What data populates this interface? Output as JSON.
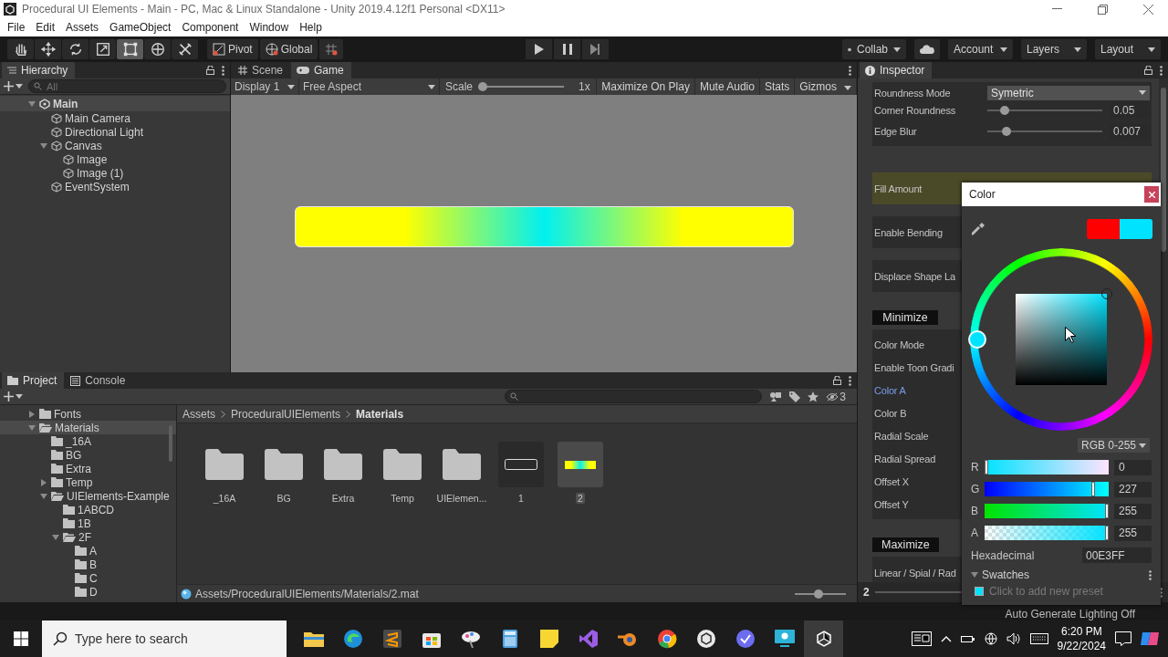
{
  "window": {
    "title": "Procedural UI Elements - Main - PC, Mac & Linux Standalone - Unity 2019.4.12f1 Personal <DX11>"
  },
  "menu": [
    "File",
    "Edit",
    "Assets",
    "GameObject",
    "Component",
    "Window",
    "Help"
  ],
  "toolbar": {
    "tools": [
      {
        "kind": "hand",
        "selected": false
      },
      {
        "kind": "move",
        "selected": false
      },
      {
        "kind": "rotate",
        "selected": false
      },
      {
        "kind": "scale",
        "selected": false
      },
      {
        "kind": "rect",
        "selected": true
      },
      {
        "kind": "transform",
        "selected": false
      },
      {
        "kind": "custom",
        "selected": false
      }
    ],
    "pivot": "Pivot",
    "global": "Global",
    "collab": "Collab",
    "account": "Account",
    "layers": "Layers",
    "layout": "Layout"
  },
  "hierarchy": {
    "title": "Hierarchy",
    "search_placeholder": "All",
    "tree": [
      {
        "kind": "scene",
        "label": "Main",
        "expanded": true,
        "children": [
          {
            "kind": "object",
            "label": "Main Camera"
          },
          {
            "kind": "object",
            "label": "Directional Light"
          },
          {
            "kind": "object",
            "label": "Canvas",
            "expanded": true,
            "children": [
              {
                "kind": "object",
                "label": "Image"
              },
              {
                "kind": "object",
                "label": "Image (1)"
              }
            ]
          },
          {
            "kind": "object",
            "label": "EventSystem"
          }
        ]
      }
    ]
  },
  "game": {
    "tabs": [
      {
        "label": "Scene",
        "kind": "scene",
        "selected": false
      },
      {
        "label": "Game",
        "kind": "game",
        "selected": true
      }
    ],
    "display": "Display 1",
    "aspect": "Free Aspect",
    "scale": {
      "label": "Scale",
      "level": 0,
      "value": "1x"
    },
    "buttons": [
      "Maximize On Play",
      "Mute Audio",
      "Stats",
      "Gizmos"
    ]
  },
  "project": {
    "tabs": [
      {
        "label": "Project",
        "kind": "project",
        "selected": true
      },
      {
        "label": "Console",
        "kind": "console",
        "selected": false
      }
    ],
    "hidden_count": "3",
    "tree": [
      {
        "label": "Fonts",
        "expanded": false,
        "selected": false
      },
      {
        "label": "Materials",
        "expanded": true,
        "selected": true,
        "children": [
          {
            "label": "_16A",
            "selected": false
          },
          {
            "label": "BG",
            "selected": false
          },
          {
            "label": "Extra",
            "selected": false
          },
          {
            "label": "Temp",
            "expanded": false,
            "selected": false
          },
          {
            "label": "UIElements-Example",
            "expanded": true,
            "selected": false,
            "children": [
              {
                "label": "1ABCD",
                "selected": false
              },
              {
                "label": "1B",
                "selected": false
              },
              {
                "label": "2F",
                "expanded": true,
                "selected": false,
                "children": [
                  {
                    "label": "A",
                    "selected": false
                  },
                  {
                    "label": "B",
                    "selected": false
                  },
                  {
                    "label": "C",
                    "selected": false
                  },
                  {
                    "label": "D",
                    "selected": false
                  }
                ]
              }
            ]
          }
        ]
      }
    ],
    "breadcrumb": [
      "Assets",
      "ProceduralUIElements",
      "Materials"
    ],
    "assets": [
      {
        "kind": "folder",
        "label": "_16A",
        "selected": false
      },
      {
        "kind": "folder",
        "label": "BG",
        "selected": false
      },
      {
        "kind": "folder",
        "label": "Extra",
        "selected": false
      },
      {
        "kind": "folder",
        "label": "Temp",
        "selected": false
      },
      {
        "kind": "folder",
        "label": "UIElemen...",
        "selected": false
      },
      {
        "kind": "outline",
        "label": "1",
        "selected": false
      },
      {
        "kind": "gradient",
        "label": "2",
        "selected": true
      }
    ],
    "path": "Assets/ProceduralUIElements/Materials/2.mat",
    "icon_size": {
      "level": 0.45
    }
  },
  "inspector": {
    "title": "Inspector",
    "groups": [
      {
        "kind": "box",
        "highlighted": false,
        "rows": [
          {
            "kind": "dropdown",
            "label": "Roundness Mode",
            "value": "Symetric"
          },
          {
            "kind": "slider",
            "label": "Corner Roundness",
            "level": 0.12,
            "value": "0.05"
          },
          {
            "kind": "slider",
            "label": "Edge Blur",
            "level": 0.14,
            "value": "0.007"
          }
        ]
      },
      {
        "kind": "box",
        "highlighted": true,
        "rows": [
          {
            "kind": "label",
            "label": "Fill Amount",
            "focused": false
          }
        ]
      },
      {
        "kind": "box",
        "highlighted": false,
        "rows": [
          {
            "kind": "label",
            "label": "Enable Bending",
            "focused": false
          }
        ]
      },
      {
        "kind": "box",
        "highlighted": false,
        "rows": [
          {
            "kind": "label",
            "label": "Displace Shape La",
            "focused": false
          }
        ]
      },
      {
        "kind": "header",
        "label": "Minimize"
      },
      {
        "kind": "box",
        "highlighted": false,
        "rows": [
          {
            "kind": "label",
            "label": "Color Mode",
            "focused": false
          },
          {
            "kind": "label",
            "label": "Enable Toon Gradi",
            "focused": false
          },
          {
            "kind": "label",
            "label": "Color A",
            "focused": true
          },
          {
            "kind": "label",
            "label": "Color B",
            "focused": false
          },
          {
            "kind": "label",
            "label": "Radial Scale",
            "focused": false
          },
          {
            "kind": "label",
            "label": "Radial Spread",
            "focused": false
          },
          {
            "kind": "label",
            "label": "Offset X",
            "focused": false
          },
          {
            "kind": "label",
            "label": "Offset Y",
            "focused": false
          }
        ]
      },
      {
        "kind": "header",
        "label": "Maximize"
      },
      {
        "kind": "box",
        "highlighted": false,
        "rows": [
          {
            "kind": "label",
            "label": "Linear / Spial / Rad",
            "focused": false
          }
        ]
      }
    ],
    "preview": "2"
  },
  "color_picker": {
    "title": "Color",
    "swatches": [
      {
        "kind": "previous",
        "color": "#ff0000"
      },
      {
        "kind": "current",
        "color": "#00e3ff"
      }
    ],
    "mode": "RGB 0-255",
    "channels": [
      {
        "kind": "red",
        "label": "R",
        "value": "0",
        "level": 0
      },
      {
        "kind": "green",
        "label": "G",
        "value": "227",
        "level": 0.89
      },
      {
        "kind": "blue",
        "label": "B",
        "value": "255",
        "level": 1
      },
      {
        "kind": "alpha",
        "label": "A",
        "value": "255",
        "level": 1
      }
    ],
    "hex_label": "Hexadecimal",
    "hex": "00E3FF",
    "swatches_title": "Swatches",
    "swatches_expanded": true,
    "preset_hint": "Click to add new preset"
  },
  "status_bar": {
    "text": "Auto Generate Lighting Off"
  },
  "taskbar": {
    "search_placeholder": "Type here to search",
    "time": "6:20 PM",
    "date": "9/22/2024"
  }
}
